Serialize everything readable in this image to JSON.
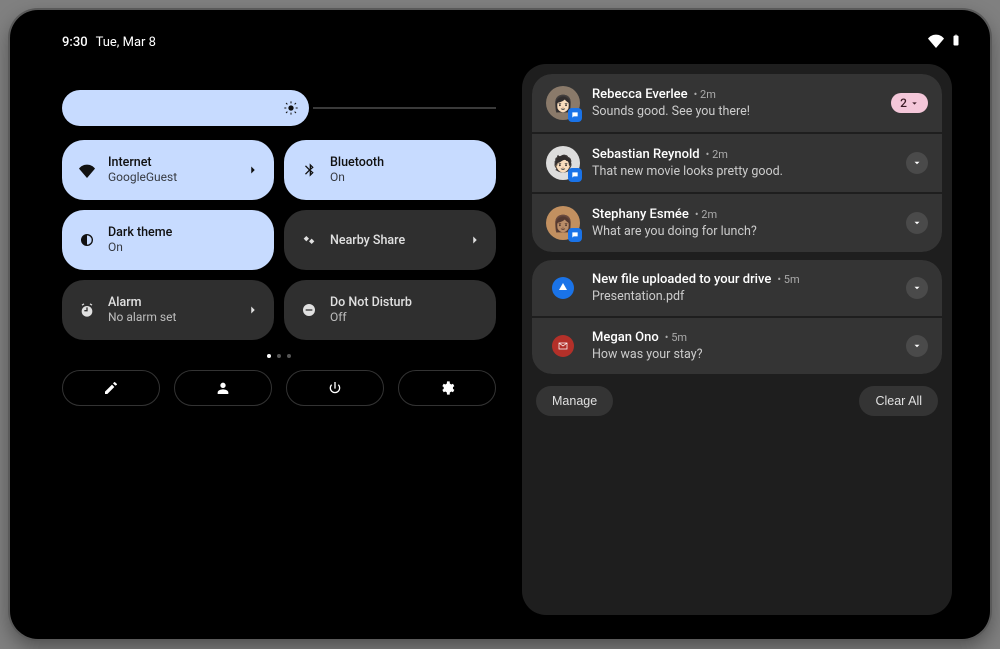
{
  "statusbar": {
    "time": "9:30",
    "date": "Tue, Mar 8"
  },
  "brightness": {
    "pct": 56
  },
  "tiles": [
    {
      "id": "internet",
      "title": "Internet",
      "sub": "GoogleGuest",
      "active": true,
      "icon": "wifi",
      "chevron": true
    },
    {
      "id": "bluetooth",
      "title": "Bluetooth",
      "sub": "On",
      "active": true,
      "icon": "bluetooth",
      "chevron": false
    },
    {
      "id": "darktheme",
      "title": "Dark theme",
      "sub": "On",
      "active": true,
      "icon": "contrast",
      "chevron": false
    },
    {
      "id": "nearby",
      "title": "Nearby Share",
      "sub": "",
      "active": false,
      "icon": "nearby",
      "chevron": true
    },
    {
      "id": "alarm",
      "title": "Alarm",
      "sub": "No alarm set",
      "active": false,
      "icon": "alarm",
      "chevron": true
    },
    {
      "id": "dnd",
      "title": "Do Not Disturb",
      "sub": "Off",
      "active": false,
      "icon": "dnd",
      "chevron": false
    }
  ],
  "pager": {
    "count": 3,
    "active": 0
  },
  "bottom_buttons": [
    "edit",
    "user",
    "power",
    "settings"
  ],
  "conversations": [
    {
      "avatar_color": "#8a7a6a",
      "name": "Rebecca Everlee",
      "time": "2m",
      "text": "Sounds good. See you there!",
      "expand": "count",
      "count": 2
    },
    {
      "avatar_color": "#cccccc",
      "name": "Sebastian Reynold",
      "time": "2m",
      "text": "That new movie looks pretty good.",
      "expand": "chevron"
    },
    {
      "avatar_color": "#c29060",
      "name": "Stephany Esmée",
      "time": "2m",
      "text": "What are you doing for lunch?",
      "expand": "chevron"
    }
  ],
  "other_notifs": [
    {
      "app": "drive",
      "title": "New file uploaded to your drive",
      "time": "5m",
      "text": "Presentation.pdf"
    },
    {
      "app": "gmail",
      "title": "Megan Ono",
      "time": "5m",
      "text": "How was your stay?"
    }
  ],
  "actions": {
    "manage": "Manage",
    "clear": "Clear All"
  }
}
